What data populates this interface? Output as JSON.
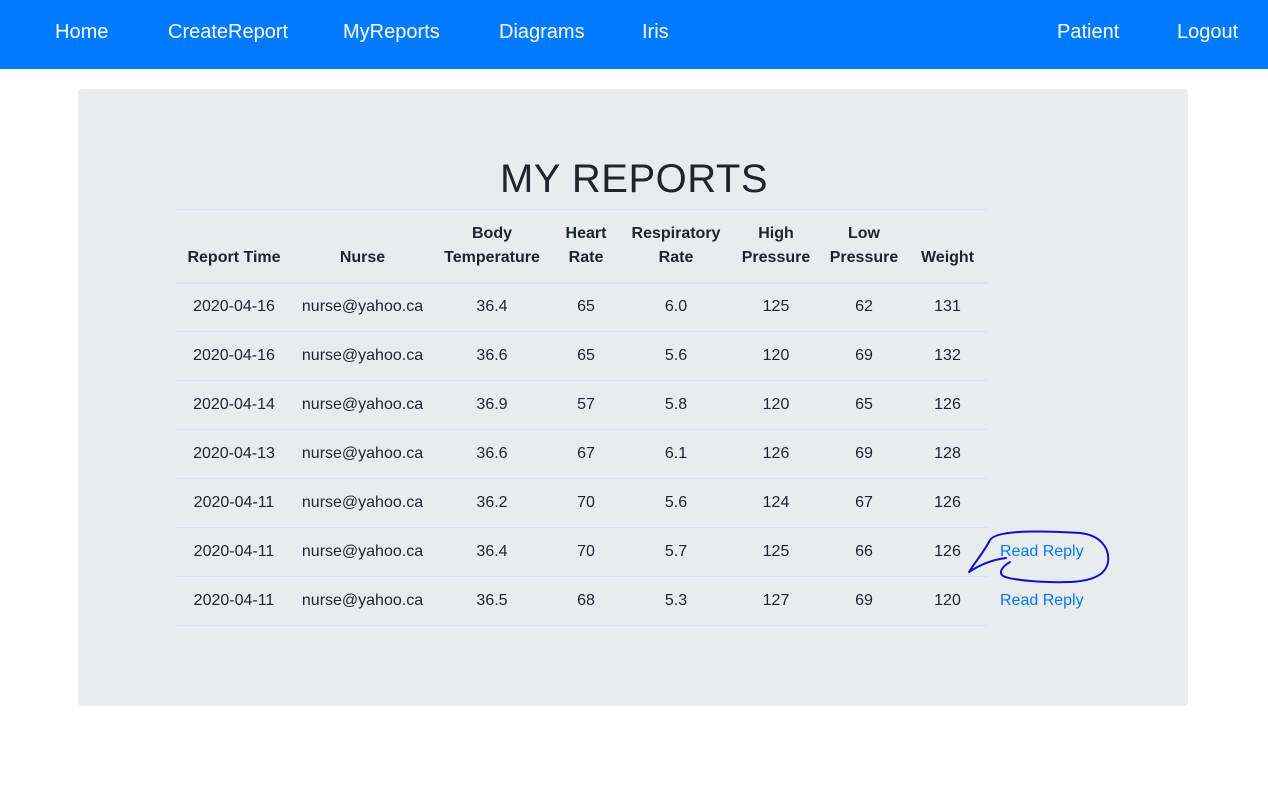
{
  "navbar": {
    "left_items": [
      {
        "label": "Home"
      },
      {
        "label": "CreateReport"
      },
      {
        "label": "MyReports"
      },
      {
        "label": "Diagrams"
      },
      {
        "label": "Iris"
      }
    ],
    "right_items": [
      {
        "label": "Patient"
      },
      {
        "label": "Logout"
      }
    ]
  },
  "page": {
    "title": "MY REPORTS"
  },
  "table": {
    "headers": [
      {
        "line1": "",
        "line2": "Report Time"
      },
      {
        "line1": "",
        "line2": "Nurse"
      },
      {
        "line1": "Body",
        "line2": "Temperature"
      },
      {
        "line1": "Heart",
        "line2": "Rate"
      },
      {
        "line1": "Respiratory",
        "line2": "Rate"
      },
      {
        "line1": "High",
        "line2": "Pressure"
      },
      {
        "line1": "Low",
        "line2": "Pressure"
      },
      {
        "line1": "",
        "line2": "Weight"
      }
    ],
    "rows": [
      {
        "cells": [
          "2020-04-16",
          "nurse@yahoo.ca",
          "36.4",
          "65",
          "6.0",
          "125",
          "62",
          "131"
        ],
        "reply": ""
      },
      {
        "cells": [
          "2020-04-16",
          "nurse@yahoo.ca",
          "36.6",
          "65",
          "5.6",
          "120",
          "69",
          "132"
        ],
        "reply": ""
      },
      {
        "cells": [
          "2020-04-14",
          "nurse@yahoo.ca",
          "36.9",
          "57",
          "5.8",
          "120",
          "65",
          "126"
        ],
        "reply": ""
      },
      {
        "cells": [
          "2020-04-13",
          "nurse@yahoo.ca",
          "36.6",
          "67",
          "6.1",
          "126",
          "69",
          "128"
        ],
        "reply": ""
      },
      {
        "cells": [
          "2020-04-11",
          "nurse@yahoo.ca",
          "36.2",
          "70",
          "5.6",
          "124",
          "67",
          "126"
        ],
        "reply": ""
      },
      {
        "cells": [
          "2020-04-11",
          "nurse@yahoo.ca",
          "36.4",
          "70",
          "5.7",
          "125",
          "66",
          "126"
        ],
        "reply": "Read Reply"
      },
      {
        "cells": [
          "2020-04-11",
          "nurse@yahoo.ca",
          "36.5",
          "68",
          "5.3",
          "127",
          "69",
          "120"
        ],
        "reply": "Read Reply"
      }
    ]
  },
  "colors": {
    "navbar": "#007bff",
    "panel": "#e9ecef",
    "link": "#007bff",
    "annotation": "#1010d0"
  }
}
